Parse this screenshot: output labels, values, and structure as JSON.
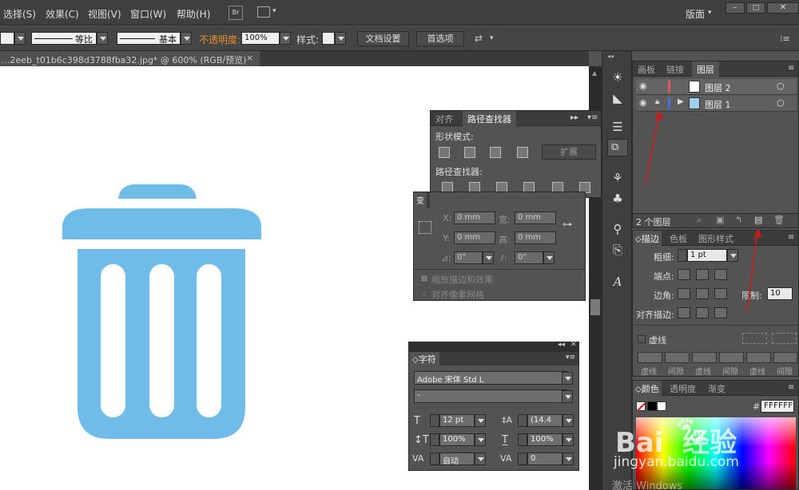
{
  "menu": [
    "选择(S)",
    "效果(C)",
    "视图(V)",
    "窗口(W)",
    "帮助(H)"
  ],
  "menu_icons": {
    "br": "Br"
  },
  "workspace": "版面",
  "controlbar": {
    "stroke_style": "等比",
    "brush_style": "基本",
    "opacity_label": "不透明度:",
    "opacity_value": "100%",
    "style_label": "样式:",
    "doc_settings": "文档设置",
    "preferences": "首选项"
  },
  "document_tab": {
    "title": "...2eeb_t01b6c398d3788fba32.jpg* @ 600% (RGB/预览)",
    "close": "×"
  },
  "pathfinder": {
    "tabs": [
      "对齐",
      "路径查找器"
    ],
    "shape_modes_label": "形状模式:",
    "expand_label": "扩展",
    "pathfinders_label": "路径查找器:"
  },
  "transform": {
    "tab": "变",
    "x_label": "X:",
    "x_value": "0 mm",
    "y_label": "Y:",
    "y_value": "0 mm",
    "w_label": "宽:",
    "w_value": "0 mm",
    "h_label": "高:",
    "h_value": "0 mm",
    "angle1": "0°",
    "angle2": "0°",
    "scale_strokes": "缩放描边和效果",
    "align_pixel": "对齐像素网格"
  },
  "character": {
    "tab": "字符",
    "font": "Adobe 宋体 Std L",
    "style": "-",
    "size": "12 pt",
    "leading": "(14.4",
    "vscale": "100%",
    "hscale": "100%",
    "kerning": "自动",
    "tracking": "0"
  },
  "layers": {
    "tabs": [
      "画板",
      "链接",
      "图层"
    ],
    "items": [
      {
        "name": "图层 2",
        "color": "#e05a5a"
      },
      {
        "name": "图层 1",
        "color": "#4a6fe0"
      }
    ],
    "count": "2 个图层"
  },
  "stroke": {
    "tabs": [
      "描边",
      "色板",
      "图形样式"
    ],
    "weight_label": "粗细:",
    "weight_value": "1 pt",
    "cap_label": "端点:",
    "corner_label": "边角:",
    "limit_label": "限制:",
    "limit_value": "10",
    "align_label": "对齐描边:",
    "dashed_label": "虚线",
    "dash_labels": [
      "虚线",
      "间隙",
      "虚线",
      "间隙",
      "虚线",
      "间隙"
    ]
  },
  "color": {
    "tabs": [
      "颜色",
      "透明度",
      "渐变"
    ],
    "hash": "#",
    "hex_value": "FFFFFF"
  },
  "watermark": {
    "brand": "Bai  经验",
    "url": "jingyan.baidu.com"
  },
  "os_overlay": "激活 Windows",
  "icon_color": "#70bce8"
}
